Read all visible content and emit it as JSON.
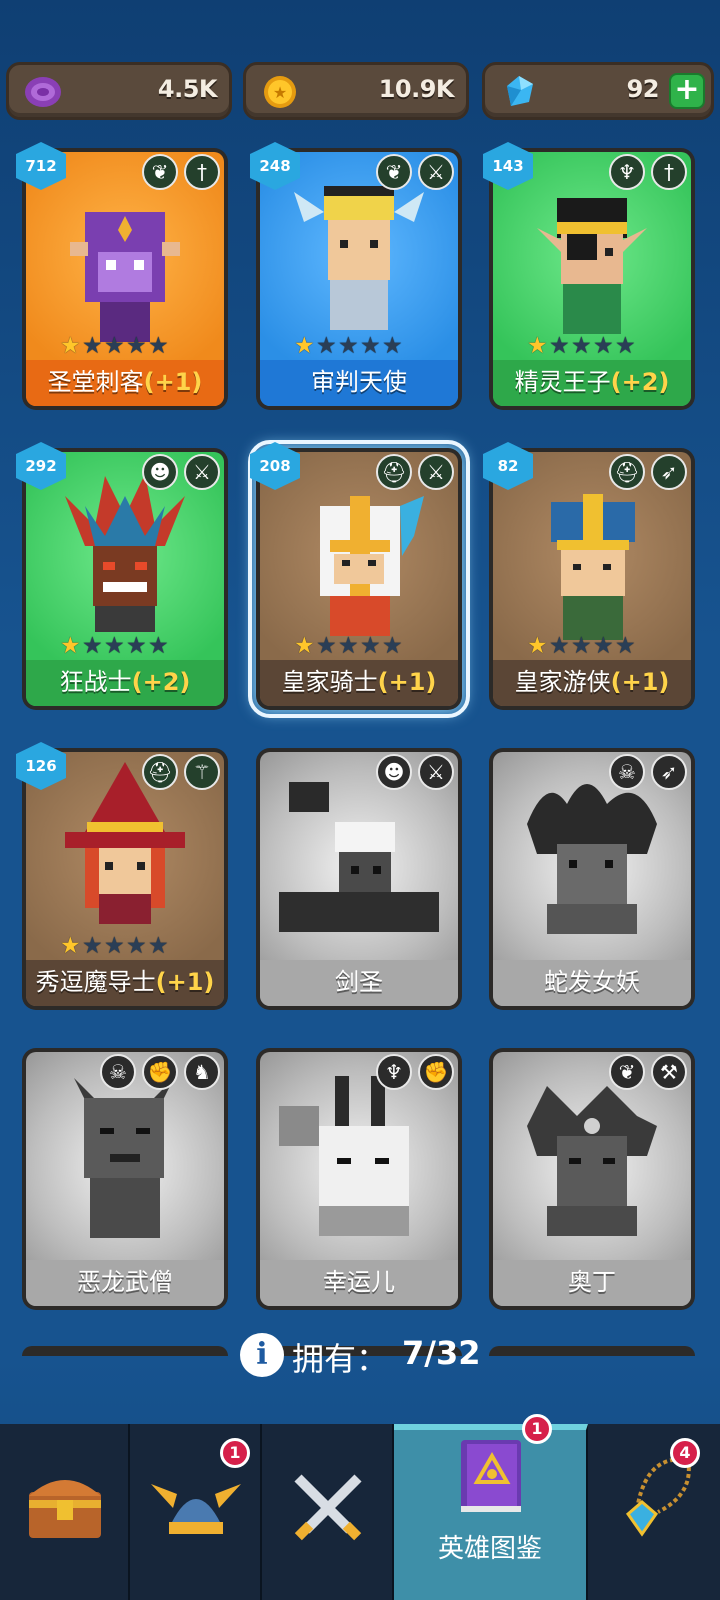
{
  "currencies": {
    "purple_orb": {
      "value": "4.5K",
      "icon": "purple-orb-icon"
    },
    "gold_coin": {
      "value": "10.9K",
      "icon": "gold-coin-icon"
    },
    "gem": {
      "value": "92",
      "icon": "blue-gem-icon",
      "add_label": "+"
    }
  },
  "heroes": [
    {
      "name": "圣堂刺客",
      "bonus": "(+1)",
      "power": "712",
      "stars": 1,
      "max_stars": 5,
      "owned": true,
      "bg": "#f08a1c",
      "namebar": "#e86a14",
      "icons": [
        "laurel-wreath-icon",
        "dagger-icon"
      ]
    },
    {
      "name": "审判天使",
      "bonus": "",
      "power": "248",
      "stars": 1,
      "max_stars": 5,
      "owned": true,
      "bg": "#2b8fe6",
      "namebar": "#1f78d6",
      "icons": [
        "laurel-wreath-icon",
        "sword-icon"
      ]
    },
    {
      "name": "精灵王子",
      "bonus": "(+2)",
      "power": "143",
      "stars": 1,
      "max_stars": 5,
      "owned": true,
      "bg": "#35c45a",
      "namebar": "#2ea84a",
      "icons": [
        "elf-icon",
        "dagger-icon"
      ]
    },
    {
      "name": "狂战士",
      "bonus": "(+2)",
      "power": "292",
      "stars": 1,
      "max_stars": 5,
      "owned": true,
      "bg": "#35c45a",
      "namebar": "#2ea84a",
      "icons": [
        "orc-icon",
        "sword-icon"
      ]
    },
    {
      "name": "皇家骑士",
      "bonus": "(+1)",
      "power": "208",
      "stars": 1,
      "max_stars": 5,
      "owned": true,
      "bg": "#8a6a4a",
      "namebar": "#5b4636",
      "icons": [
        "helmet-icon",
        "sword-icon"
      ],
      "selected": true
    },
    {
      "name": "皇家游侠",
      "bonus": "(+1)",
      "power": "82",
      "stars": 1,
      "max_stars": 5,
      "owned": true,
      "bg": "#8a6a4a",
      "namebar": "#5b4636",
      "icons": [
        "helmet-icon",
        "bow-icon"
      ]
    },
    {
      "name": "秀逗魔导士",
      "bonus": "(+1)",
      "power": "126",
      "stars": 1,
      "max_stars": 5,
      "owned": true,
      "bg": "#8a6a4a",
      "namebar": "#5b4636",
      "icons": [
        "helmet-icon",
        "staff-icon"
      ]
    },
    {
      "name": "剑圣",
      "bonus": "",
      "power": "",
      "owned": false,
      "icons": [
        "orc-icon",
        "sword-icon"
      ]
    },
    {
      "name": "蛇发女妖",
      "bonus": "",
      "power": "",
      "owned": false,
      "icons": [
        "skull-icon",
        "bow-icon"
      ]
    },
    {
      "name": "恶龙武僧",
      "bonus": "",
      "power": "",
      "owned": false,
      "icons": [
        "skull-icon",
        "fist-icon",
        "dragon-icon"
      ]
    },
    {
      "name": "幸运儿",
      "bonus": "",
      "power": "",
      "owned": false,
      "icons": [
        "elf-icon",
        "fist-icon"
      ]
    },
    {
      "name": "奥丁",
      "bonus": "",
      "power": "",
      "owned": false,
      "icons": [
        "laurel-wreath-icon",
        "hammer-icon"
      ]
    }
  ],
  "owned": {
    "label": "拥有：",
    "count": "7/32"
  },
  "bottom_nav": [
    {
      "name": "chest",
      "icon": "treasure-chest-icon",
      "label": "",
      "badge": ""
    },
    {
      "name": "heroes",
      "icon": "viking-helmet-icon",
      "label": "",
      "badge": "1"
    },
    {
      "name": "battle",
      "icon": "crossed-swords-icon",
      "label": "",
      "badge": ""
    },
    {
      "name": "codex",
      "icon": "spellbook-icon",
      "label": "英雄图鉴",
      "badge": "1",
      "active": true
    },
    {
      "name": "amulet",
      "icon": "amulet-icon",
      "label": "",
      "badge": "4"
    }
  ]
}
